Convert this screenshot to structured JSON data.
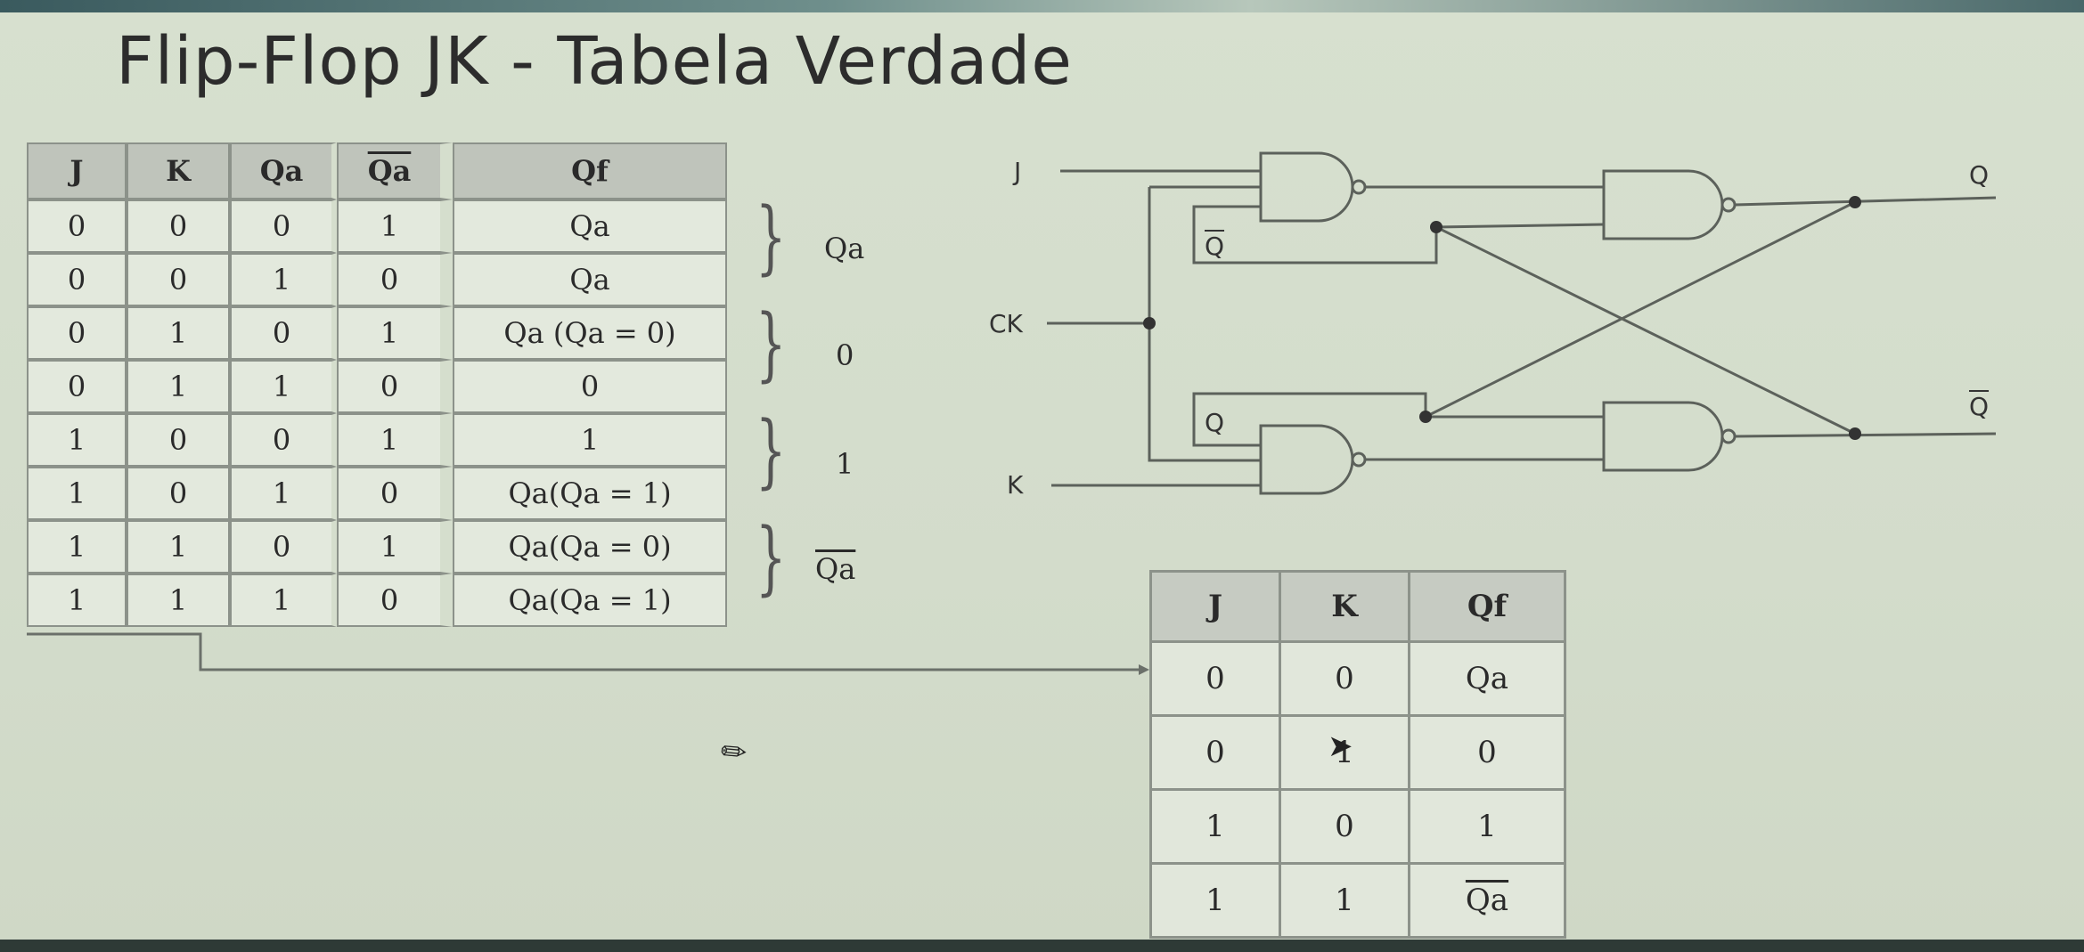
{
  "title": "Flip-Flop JK - Tabela Verdade",
  "main_table": {
    "headers": [
      "J",
      "K",
      "Qa",
      "Qa",
      "Qf"
    ],
    "rows": [
      [
        "0",
        "0",
        "0",
        "1",
        "Qa"
      ],
      [
        "0",
        "0",
        "1",
        "0",
        "Qa"
      ],
      [
        "0",
        "1",
        "0",
        "1",
        "Qa (Qa = 0)"
      ],
      [
        "0",
        "1",
        "1",
        "0",
        "0"
      ],
      [
        "1",
        "0",
        "0",
        "1",
        "1"
      ],
      [
        "1",
        "0",
        "1",
        "0",
        "Qa(Qa = 1)"
      ],
      [
        "1",
        "1",
        "0",
        "1",
        "Qa(Qa = 0)"
      ],
      [
        "1",
        "1",
        "1",
        "0",
        "Qa(Qa = 1)"
      ]
    ]
  },
  "groups": [
    "Qa",
    "0",
    "1",
    "Qa"
  ],
  "circuit": {
    "labels": {
      "j": "J",
      "ck": "CK",
      "k": "K",
      "q_out": "Q",
      "qbar_out": "Q",
      "q_fb_top": "Q",
      "q_fb_bottom": "Q"
    }
  },
  "summary_table": {
    "headers": [
      "J",
      "K",
      "Qf"
    ],
    "rows": [
      [
        "0",
        "0",
        "Qa"
      ],
      [
        "0",
        "1",
        "0"
      ],
      [
        "1",
        "0",
        "1"
      ],
      [
        "1",
        "1",
        "Qa"
      ]
    ]
  },
  "colors": {
    "background": "#d5decd",
    "header_fill": "#bfc4bb",
    "cell_fill": "#e3e9dd",
    "lines": "#5c615b"
  }
}
